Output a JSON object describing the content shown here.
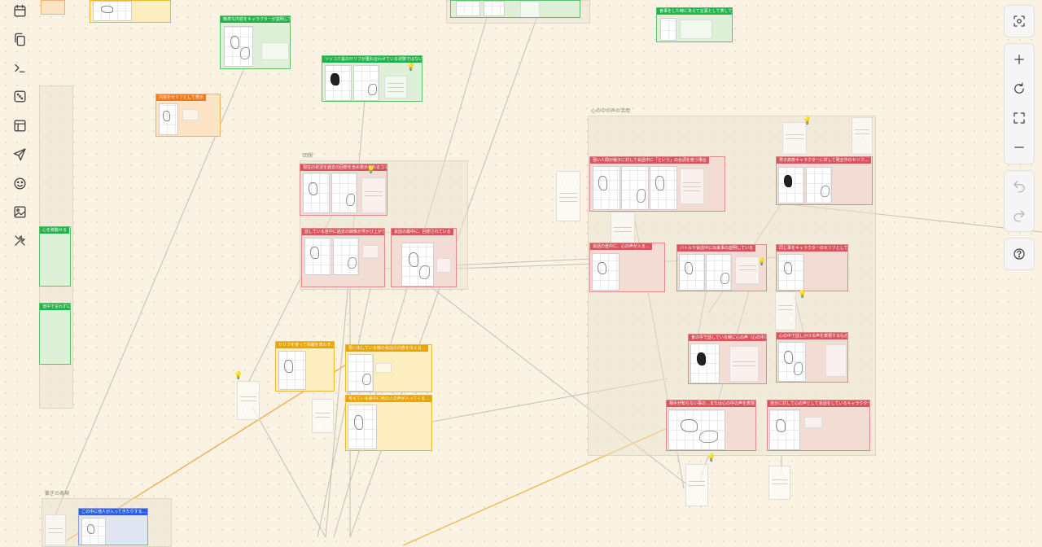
{
  "sidebar": {
    "tools": [
      {
        "icon": "calendar-icon"
      },
      {
        "icon": "copy-icon"
      },
      {
        "icon": "terminal-icon"
      },
      {
        "icon": "dice-icon"
      },
      {
        "icon": "layout-icon"
      },
      {
        "icon": "send-icon"
      },
      {
        "icon": "face-icon"
      },
      {
        "icon": "image-icon"
      },
      {
        "icon": "tools-icon"
      }
    ]
  },
  "controls": {
    "focus_icon": "focus-icon",
    "zoom_in_icon": "plus-icon",
    "reset_icon": "refresh-icon",
    "fit_icon": "fullscreen-icon",
    "zoom_out_icon": "minus-icon",
    "undo_icon": "undo-icon",
    "redo_icon": "redo-icon",
    "help_icon": "help-icon"
  },
  "groups": {
    "g1": "回想",
    "g2": "心の中の声の活用",
    "g3": "繋ぎの表現"
  },
  "cards": {
    "green1": "簡単な内容をキャラクターが説明しています",
    "green2": "ツッコミ役のセリフが重ね合わせている状態ではない場合",
    "green3": "食事をした時にあえて言葉として表している",
    "green4": "心を移動せる",
    "green5": "途中で言わずに",
    "orange1": "内容をセリフとして表示",
    "red1": "現在の状況を過去の回想を含め表示されるコマを読む…",
    "red2": "話している途中に過去の映像が浮かび上がり…",
    "red3": "会話の最中に、回想されている",
    "red4": "強い人間が様子に対して会話中に「という」の台詞を使う場合",
    "red5": "男子高校キャラクターに対して発言中のセリフ…",
    "red6": "会話の途中に、心の声が入る…",
    "red7": "バトルや会話中に出来事の説明している",
    "red8": "同じ事をキャラクターのセリフとして表す（心の…",
    "red9": "食の中で話している時に心の声（心の中）で…",
    "red10": "心の中で話しかける声を表現するもの…",
    "red11": "相手が知らない事の…または心の中の声を表現している…",
    "red12": "自分に対して心の声として会話をしているキャラクターの心の中…",
    "yellow1": "セリフを使って情報を表わす…",
    "yellow2": "思い出している時の会話の内容を伝える…",
    "yellow3": "考えている最中に他の人の声が入ってくる…",
    "blue1": "この中に他人が入ってきたりする…"
  }
}
